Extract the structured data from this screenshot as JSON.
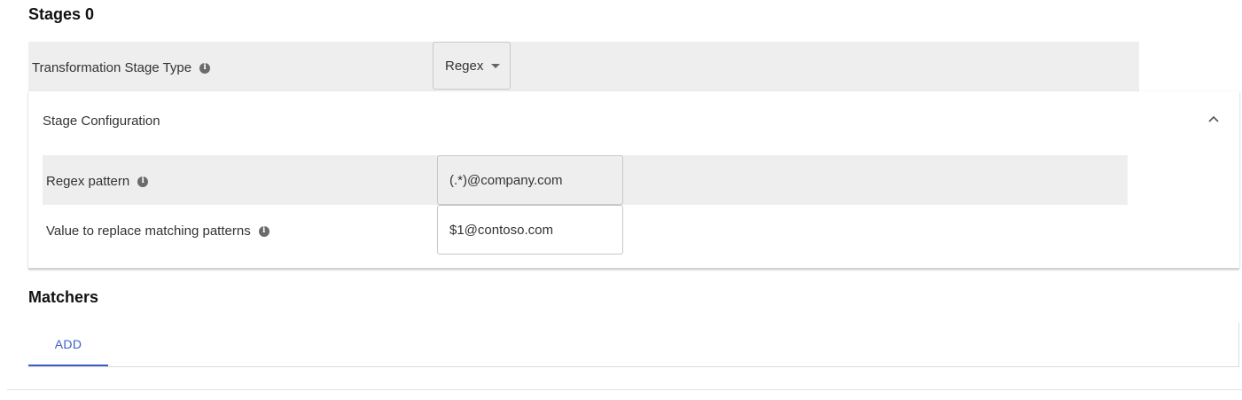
{
  "stages": {
    "title": "Stages 0",
    "stage_type": {
      "label": "Transformation Stage Type",
      "info": "i",
      "selected": "Regex"
    },
    "config": {
      "header": "Stage Configuration",
      "expanded": true,
      "regex_pattern": {
        "label": "Regex pattern",
        "info": "i",
        "value": "(.*)@company.com"
      },
      "replace_value": {
        "label": "Value to replace matching patterns",
        "info": "i",
        "value": "$1@contoso.com"
      }
    }
  },
  "matchers": {
    "title": "Matchers",
    "add_label": "ADD"
  },
  "colors": {
    "accent": "#3b5fc4",
    "row_shade": "#eeeeee",
    "info_icon": "#6b6b6b"
  }
}
